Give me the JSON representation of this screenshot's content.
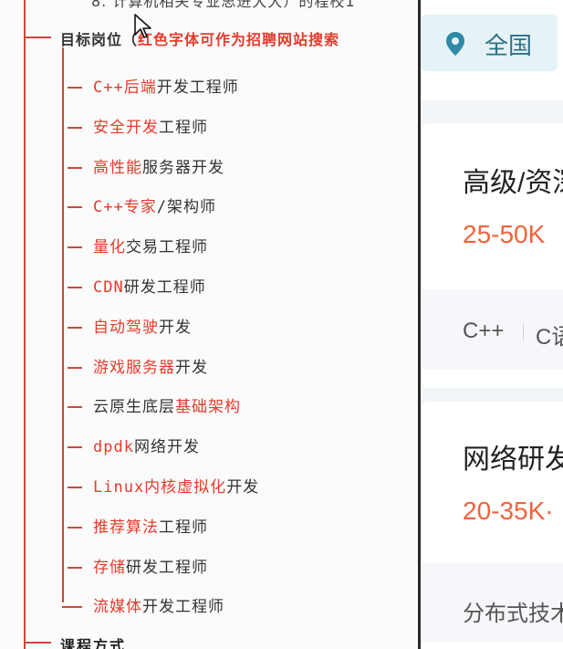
{
  "mindmap": {
    "top_cut_text": "8. 计算机相关专业思进大大）的程校1",
    "heading_prefix": "目标岗位（",
    "heading_red": "红色字体可作为招聘网站搜索",
    "items": [
      {
        "red": "C++后端",
        "black": "开发工程师"
      },
      {
        "red": "安全开发",
        "black": "工程师"
      },
      {
        "red": "高性能",
        "black": "服务器开发"
      },
      {
        "red": "C++专家",
        "black": "/架构师"
      },
      {
        "red": "量化",
        "black": "交易工程师"
      },
      {
        "red": "CDN",
        "black": "研发工程师"
      },
      {
        "red": "自动驾驶",
        "black": "开发"
      },
      {
        "red": "游戏服务器",
        "black": "开发"
      },
      {
        "black": "云原生底层",
        "red": "基础架构",
        "order": "black-first"
      },
      {
        "red": "dpdk",
        "black": "网络开发"
      },
      {
        "red": "Linux内核虚拟化",
        "black": "开发"
      },
      {
        "red": "推荐算法",
        "black": "工程师"
      },
      {
        "red": "存储",
        "black": "研发工程师"
      },
      {
        "red": "流媒体",
        "black": "开发工程师"
      }
    ],
    "bottom_heading": "课程方式"
  },
  "jobs_panel": {
    "location": "全国",
    "location_icon": "location-pin-icon",
    "colors": {
      "accent": "#2e6f86",
      "salary": "#f2623c",
      "mindmap_red": "#e53b2c"
    },
    "cards": [
      {
        "title": "高级/资深",
        "salary": "25-50K",
        "tags": [
          "C++",
          "C语"
        ]
      },
      {
        "title": "网络研发",
        "salary": "20-35K·",
        "tags": [
          "分布式技术"
        ]
      }
    ]
  }
}
